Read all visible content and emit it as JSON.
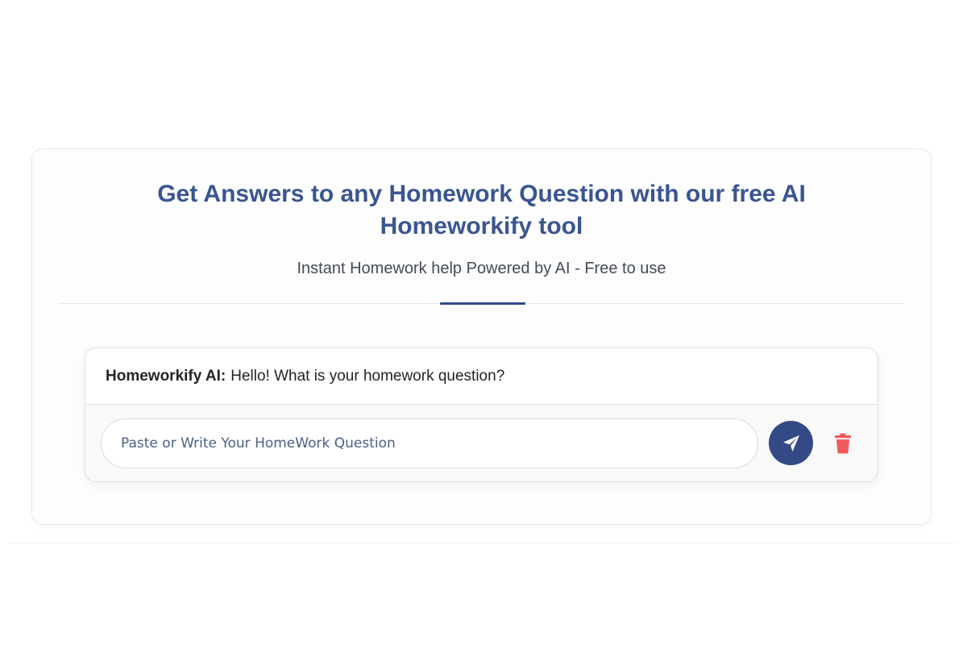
{
  "header": {
    "title_line1": "Get Answers to any Homework Question with our free AI",
    "title_line2": "Homeworkify tool",
    "subtitle": "Instant Homework help Powered by AI - Free to use"
  },
  "chat": {
    "messages": [
      {
        "sender": "Homeworkify AI:",
        "text": "Hello! What is your homework question?"
      }
    ],
    "input": {
      "value": "",
      "placeholder": "Paste or Write Your HomeWork Question"
    },
    "send_icon": "paper-plane-icon",
    "clear_icon": "trash-icon"
  },
  "colors": {
    "title": "#3a5590",
    "accent": "#344a86",
    "trash": "#f05a5a"
  }
}
